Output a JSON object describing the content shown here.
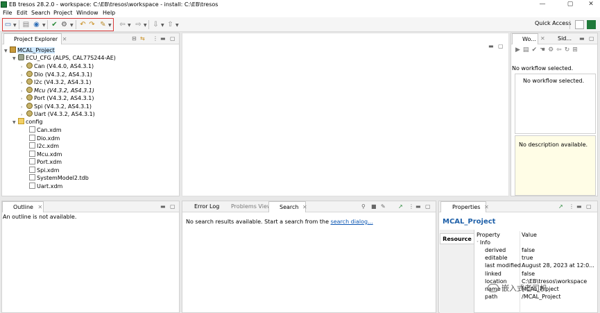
{
  "window": {
    "title": "EB tresos 28.2.0 - workspace: C:\\EB\\tresos\\workspace - install: C:\\EB\\tresos",
    "controls": [
      "—",
      "▢",
      "✕"
    ]
  },
  "menu": [
    "File",
    "Edit",
    "Search",
    "Project",
    "Window",
    "Help"
  ],
  "toolbar": {
    "quick_access": "Quick Access"
  },
  "project_explorer": {
    "tab_label": "Project Explorer",
    "project": "MCAL_Project",
    "ecu": "ECU_CFG (ALPS, CAL77S244-AE)",
    "modules": [
      {
        "label": "Can (V4.4.0, AS4.3.1)",
        "italic": false
      },
      {
        "label": "Dio (V4.3.2, AS4.3.1)",
        "italic": false
      },
      {
        "label": "I2c (V4.3.2, AS4.3.1)",
        "italic": false
      },
      {
        "label": "Mcu (V4.3.2, AS4.3.1)",
        "italic": true
      },
      {
        "label": "Port (V4.3.2, AS4.3.1)",
        "italic": false
      },
      {
        "label": "Spi (V4.3.2, AS4.3.1)",
        "italic": false
      },
      {
        "label": "Uart (V4.3.2, AS4.3.1)",
        "italic": false
      }
    ],
    "config_folder": "config",
    "files": [
      "Can.xdm",
      "Dio.xdm",
      "I2c.xdm",
      "Mcu.xdm",
      "Port.xdm",
      "Spi.xdm",
      "SystemModel2.tdb",
      "Uart.xdm"
    ]
  },
  "workflow": {
    "tab1": "Wo...",
    "tab2": "Sid...",
    "none_selected": "No workflow selected.",
    "list_text": "No workflow selected.",
    "description": "No description available."
  },
  "outline": {
    "tab_label": "Outline",
    "message": "An outline is not available."
  },
  "bottom_center": {
    "tabs": [
      "Error Log",
      "Problems View",
      "Search"
    ],
    "message_prefix": "No search results available. Start a search from the",
    "message_link": "search dialog..."
  },
  "properties": {
    "tab_label": "Properties",
    "title": "MCAL_Project",
    "side_tab": "Resource",
    "headers": [
      "Property",
      "Value"
    ],
    "section": "Info",
    "rows": [
      {
        "property": "derived",
        "value": "false"
      },
      {
        "property": "editable",
        "value": "true"
      },
      {
        "property": "last modified",
        "value": "August 28, 2023 at 12:0..."
      },
      {
        "property": "linked",
        "value": "false"
      },
      {
        "property": "location",
        "value": "C:\\EB\\tresos\\workspace"
      },
      {
        "property": "name",
        "value": "MCAL_Project"
      },
      {
        "property": "path",
        "value": "/MCAL_Project"
      }
    ]
  },
  "watermark": "嵌入式老司机"
}
